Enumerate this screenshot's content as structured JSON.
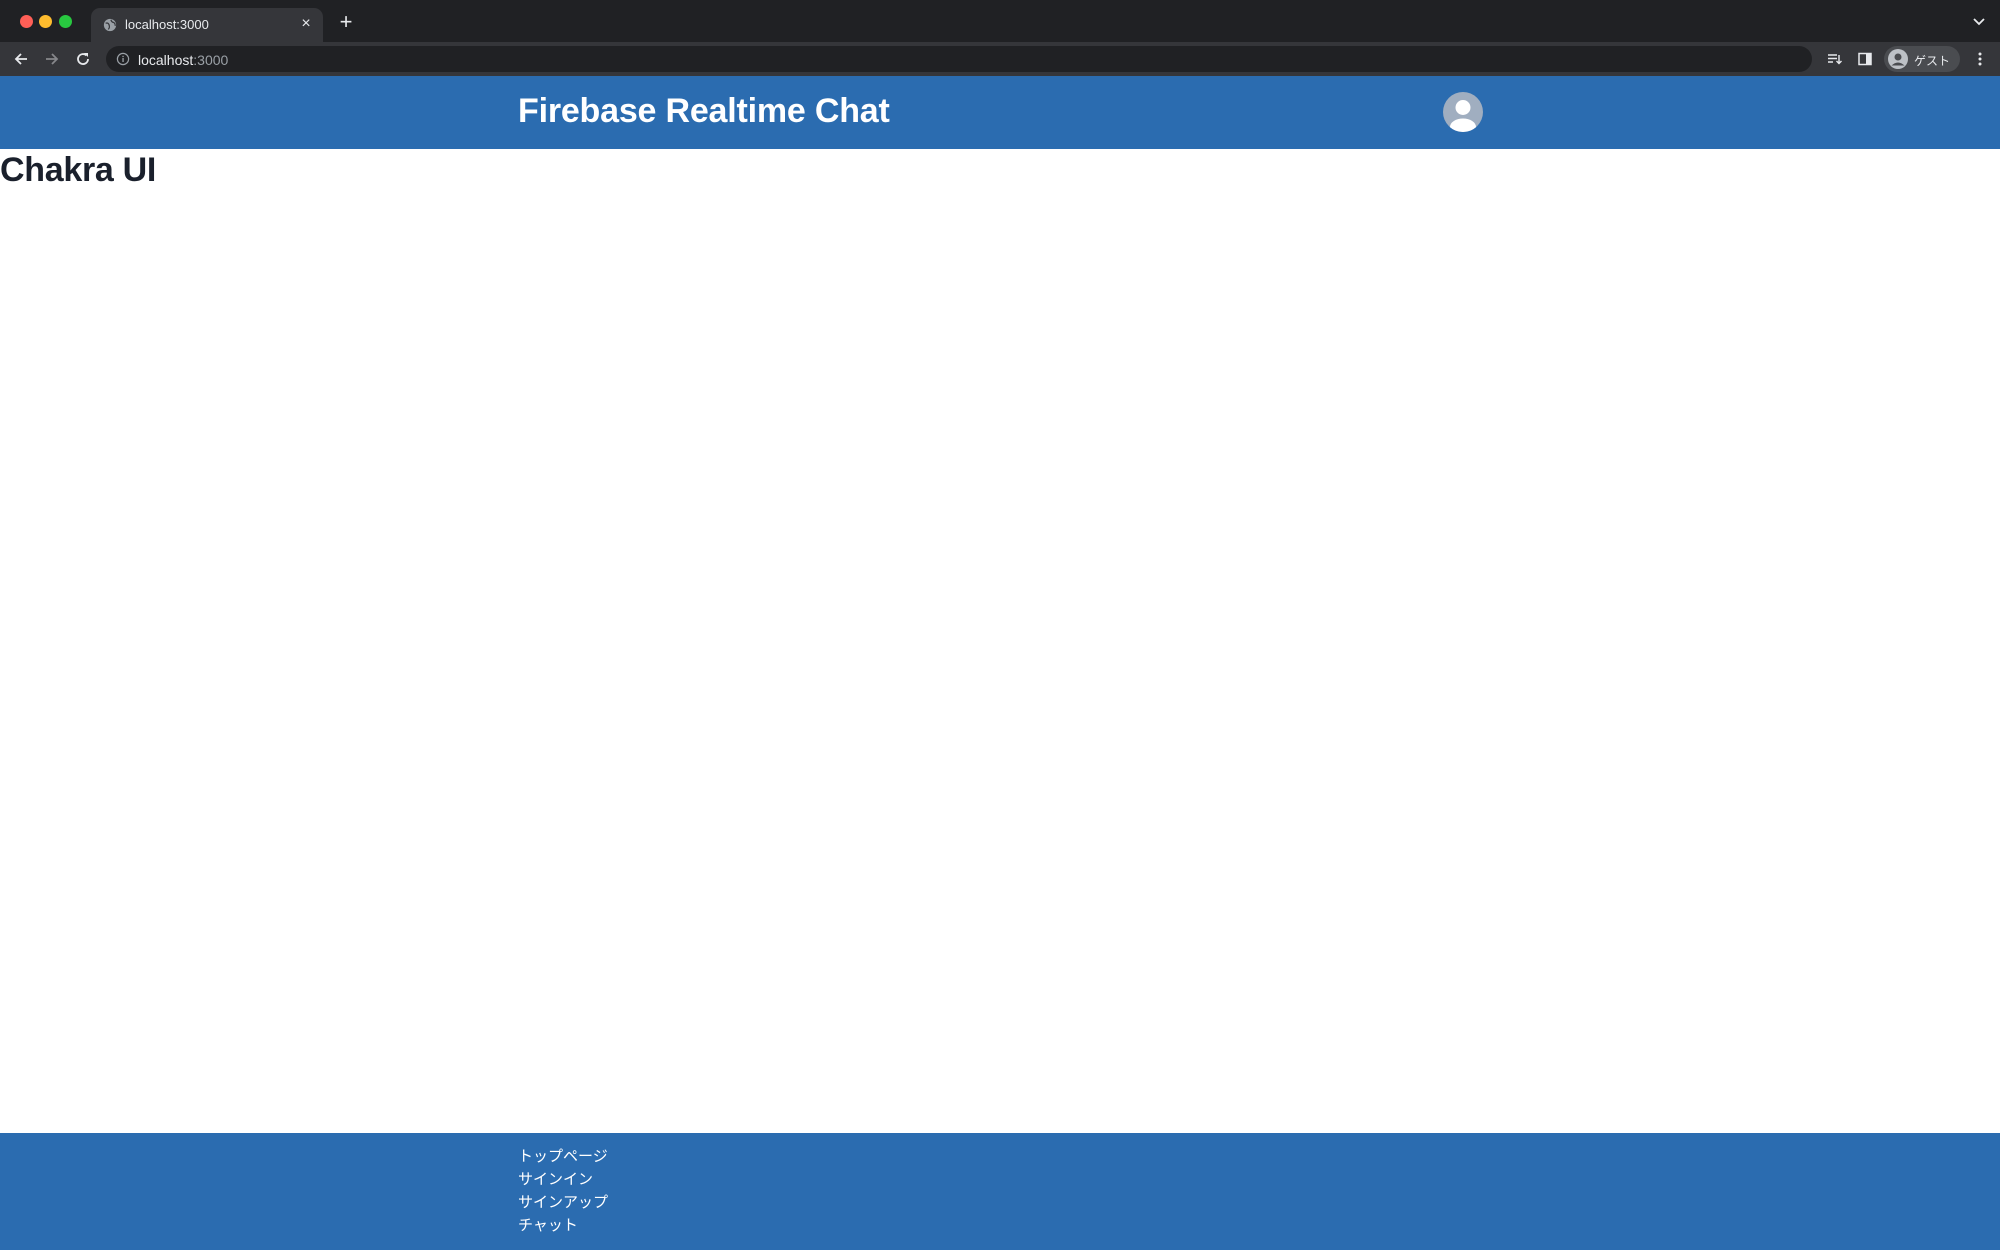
{
  "browser": {
    "tab_title": "localhost:3000",
    "tab_close_glyph": "×",
    "new_tab_glyph": "+",
    "url_host": "localhost",
    "url_port": ":3000",
    "profile_label": "ゲスト",
    "icons": [
      "globe-icon",
      "close-icon",
      "plus-icon",
      "chevron-down-icon",
      "back-arrow-icon",
      "forward-arrow-icon",
      "reload-icon",
      "info-icon",
      "reading-list-icon",
      "side-panel-icon",
      "profile-avatar-icon",
      "kebab-menu-icon"
    ]
  },
  "header": {
    "title": "Firebase Realtime Chat",
    "avatar_icon": "user-avatar-icon",
    "color": "#2b6cb0"
  },
  "main": {
    "heading": "Chakra UI"
  },
  "footer": {
    "links": [
      "トップページ",
      "サインイン",
      "サインアップ",
      "チャット"
    ],
    "color": "#2b6cb0"
  }
}
